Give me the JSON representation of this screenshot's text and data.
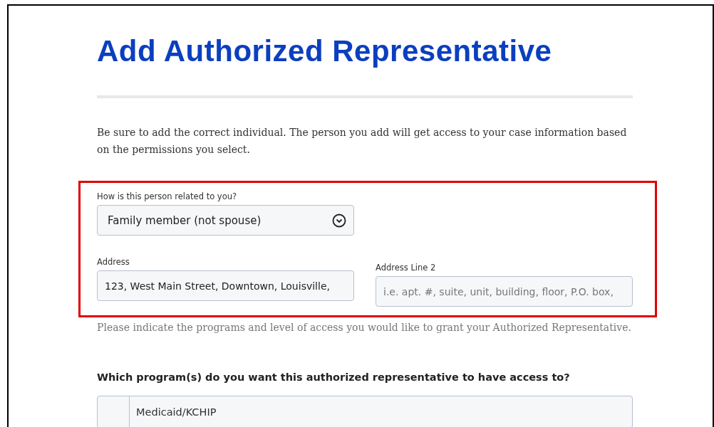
{
  "title": "Add Authorized Representative",
  "intro": "Be sure to add the correct individual. The person you add will get access to your case information based on the permissions you select.",
  "relationship": {
    "label": "How is this person related to you?",
    "value": "Family member (not spouse)"
  },
  "address": {
    "label": "Address",
    "value": "123, West Main Street, Downtown, Louisville,"
  },
  "address_line_2": {
    "label": "Address Line 2",
    "placeholder": "i.e. apt. #, suite, unit, building, floor, P.O. box,"
  },
  "programs_note": "Please indicate the programs and level of access you would like to grant your Authorized Representative.",
  "programs_question": "Which program(s) do you want this authorized representative to have access to?",
  "programs": [
    {
      "label": "Medicaid/KCHIP",
      "checked": false
    }
  ]
}
